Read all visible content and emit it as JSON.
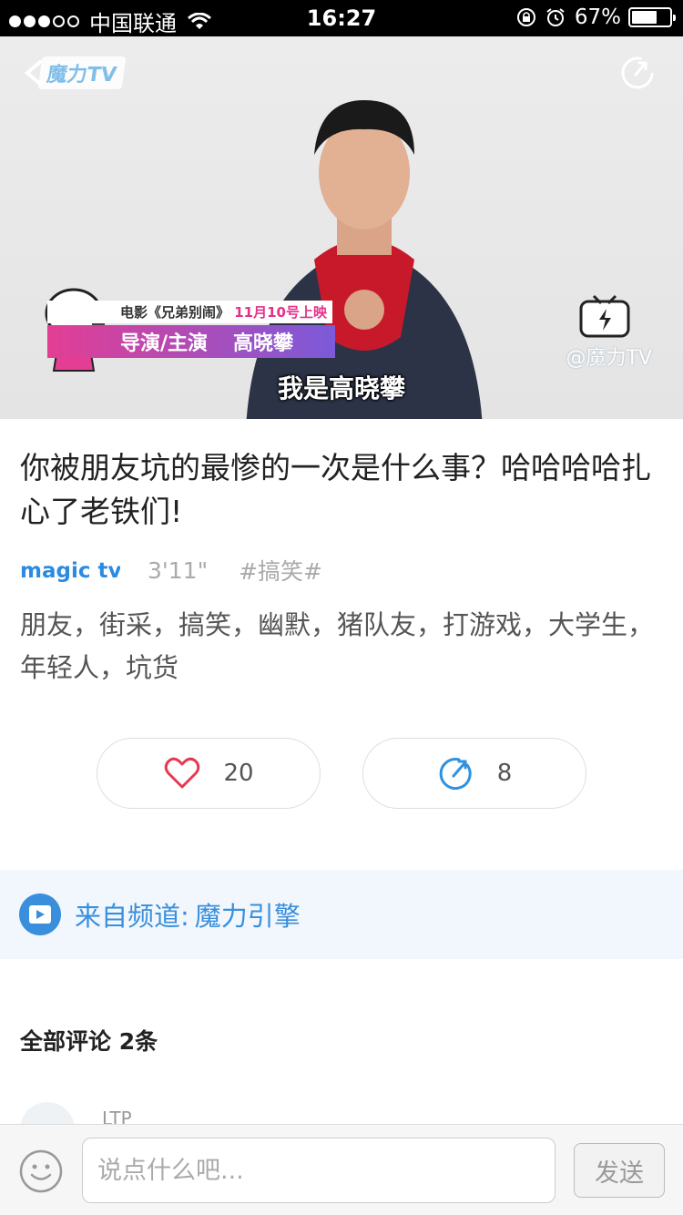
{
  "status_bar": {
    "carrier": "中国联通",
    "time": "16:27",
    "battery_text": "67%",
    "battery_level": 0.67,
    "signal_bars_filled": 3,
    "signal_bars_total": 5
  },
  "video": {
    "logo": "魔力TV",
    "caption_movie": "电影《兄弟别闹》",
    "caption_date": "11月10号上映",
    "caption_role": "导演/主演",
    "caption_name": "高晓攀",
    "subtitle": "我是高晓攀",
    "watermark": "@魔力TV",
    "accent_color": "#e33e93"
  },
  "article": {
    "title": "你被朋友坑的最惨的一次是什么事？哈哈哈哈扎心了老铁们!",
    "source_brand": "magic tv",
    "duration": "3'11\"",
    "hashtag": "#搞笑#",
    "keywords": "朋友，街采，搞笑，幽默，猪队友，打游戏，大学生，年轻人，坑货"
  },
  "actions": {
    "like_count": "20",
    "share_count": "8"
  },
  "channel": {
    "label": "来自频道:",
    "name": "魔力引擎",
    "color": "#3a8fdc"
  },
  "comments": {
    "header": "全部评论 2条",
    "first_user": "LTP"
  },
  "bottom_bar": {
    "input_placeholder": "说点什么吧...",
    "send_label": "发送"
  }
}
